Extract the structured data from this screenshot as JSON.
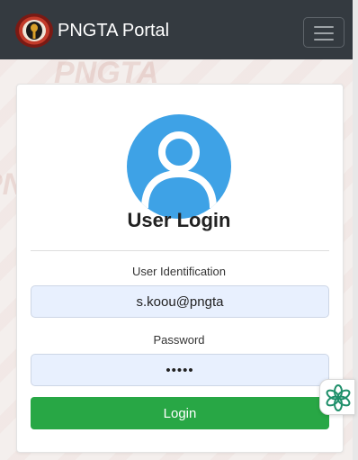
{
  "navbar": {
    "brand": "PNGTA Portal",
    "logo_icon": "pngta-logo-icon",
    "toggle_icon": "hamburger-menu-icon"
  },
  "login": {
    "title": "User Login",
    "avatar_icon": "user-avatar-icon",
    "user_id_label": "User Identification",
    "user_id_value": "s.koou@pngta",
    "password_label": "Password",
    "password_value": "•••••",
    "submit_label": "Login"
  },
  "floating_widget": {
    "icon": "assistant-flower-icon"
  },
  "colors": {
    "navbar": "#343a40",
    "avatar": "#3ea2e6",
    "login_button": "#28a745",
    "input_bg": "#e8f0fe"
  }
}
